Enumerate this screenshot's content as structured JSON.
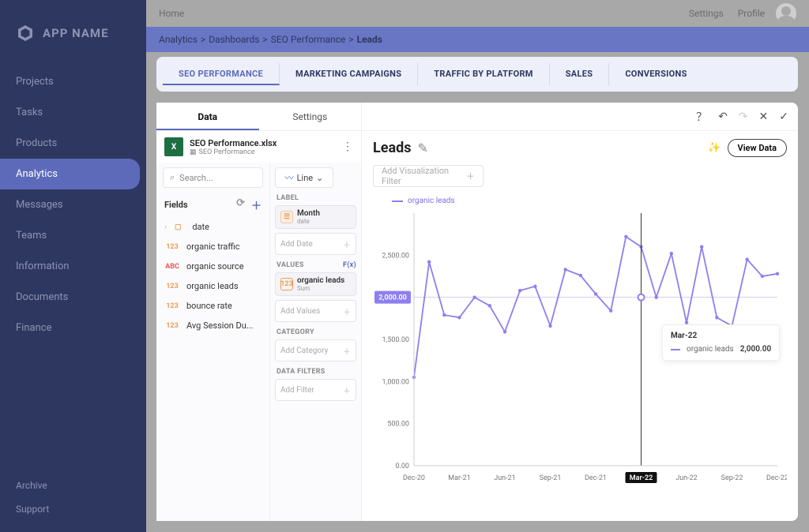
{
  "app": {
    "name": "APP NAME"
  },
  "sidebar": {
    "items": [
      "Projects",
      "Tasks",
      "Products",
      "Analytics",
      "Messages",
      "Teams",
      "Information",
      "Documents",
      "Finance"
    ],
    "active_index": 3,
    "bottom": [
      "Archive",
      "Support"
    ]
  },
  "topbar": {
    "home": "Home",
    "settings": "Settings",
    "profile": "Profile"
  },
  "breadcrumb": [
    "Analytics",
    "Dashboards",
    "SEO Performance",
    "Leads"
  ],
  "dashboard_tabs": [
    "SEO PERFORMANCE",
    "MARKETING CAMPAIGNS",
    "TRAFFIC BY PLATFORM",
    "SALES",
    "CONVERSIONS"
  ],
  "dashboard_active_index": 0,
  "config": {
    "subtabs": [
      "Data",
      "Settings"
    ],
    "subtab_active": 0,
    "file": {
      "name": "SEO Performance.xlsx",
      "sheet": "SEO Performance"
    },
    "search_placeholder": "Search...",
    "chart_type": "Line",
    "fields_label": "Fields",
    "fields": [
      {
        "type": "date",
        "label": "date"
      },
      {
        "type": "num",
        "label": "organic traffic"
      },
      {
        "type": "text",
        "label": "organic source"
      },
      {
        "type": "num",
        "label": "organic leads"
      },
      {
        "type": "num",
        "label": "bounce rate"
      },
      {
        "type": "num",
        "label": "Avg Session Du..."
      }
    ],
    "sections": {
      "label_title": "LABEL",
      "label_chip": {
        "title": "Month",
        "sub": "date"
      },
      "label_empty": "Add Date",
      "values_title": "VALUES",
      "values_fx": "F(x)",
      "values_chip": {
        "title": "organic leads",
        "sub": "Sum"
      },
      "values_empty": "Add Values",
      "category_title": "CATEGORY",
      "category_empty": "Add Category",
      "filters_title": "DATA FILTERS",
      "filters_empty": "Add Filter"
    }
  },
  "viz": {
    "title": "Leads",
    "filter_placeholder": "Add Visualization Filter",
    "view_data": "View Data",
    "legend": "organic leads",
    "tooltip": {
      "label": "Mar-22",
      "series": "organic leads",
      "value": "2,000.00"
    }
  },
  "chart_data": {
    "type": "line",
    "title": "Leads",
    "ylabel": "",
    "xlabel": "",
    "ylim": [
      0,
      3000
    ],
    "yticks": [
      "0.00",
      "500.00",
      "1,000.00",
      "1,500.00",
      "2,000.00",
      "2,500.00"
    ],
    "xticks": [
      "Dec-20",
      "Mar-21",
      "Jun-21",
      "Sep-21",
      "Dec-21",
      "Mar-22",
      "Jun-22",
      "Sep-22",
      "Dec-22"
    ],
    "highlight_x": "Mar-22",
    "highlight_y": "2,000.00",
    "series": [
      {
        "name": "organic leads",
        "values": [
          1050,
          2420,
          1790,
          1760,
          2000,
          1900,
          1590,
          2080,
          2130,
          1660,
          2330,
          2260,
          2040,
          1840,
          2720,
          2600,
          2000,
          2520,
          1700,
          2600,
          1760,
          1660,
          2450,
          2250,
          2280
        ]
      }
    ]
  }
}
